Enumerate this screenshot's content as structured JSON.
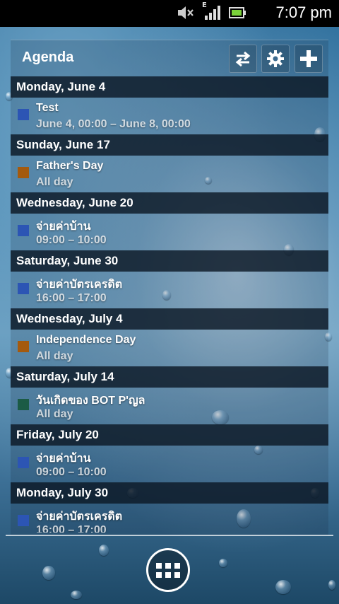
{
  "status": {
    "time": "7:07 pm",
    "network_type": "E",
    "icons": [
      "mute-icon",
      "signal-icon",
      "battery-icon"
    ]
  },
  "widget": {
    "title": "Agenda",
    "buttons": [
      "refresh-icon",
      "gear-icon",
      "plus-icon"
    ]
  },
  "colors": {
    "blue": "#2c55b4",
    "brown": "#a45a0e",
    "green": "#1b5b45"
  },
  "agenda": [
    {
      "date": "Monday, June 4",
      "title": "Test",
      "time": "June 4, 00:00 – June 8, 00:00",
      "color": "#2c55b4"
    },
    {
      "date": "Sunday, June 17",
      "title": "Father's Day",
      "time": "All day",
      "color": "#a45a0e"
    },
    {
      "date": "Wednesday, June 20",
      "title": "จ่ายค่าบ้าน",
      "time": "09:00 – 10:00",
      "color": "#2c55b4"
    },
    {
      "date": "Saturday, June 30",
      "title": "จ่ายค่าบัตรเครดิต",
      "time": "16:00 – 17:00",
      "color": "#2c55b4"
    },
    {
      "date": "Wednesday, July 4",
      "title": "Independence Day",
      "time": "All day",
      "color": "#a45a0e"
    },
    {
      "date": "Saturday, July 14",
      "title": "วันเกิดของ BOT P'ญล",
      "time": "All day",
      "color": "#1b5b45"
    },
    {
      "date": "Friday, July 20",
      "title": "จ่ายค่าบ้าน",
      "time": "09:00 – 10:00",
      "color": "#2c55b4"
    },
    {
      "date": "Monday, July 30",
      "title": "จ่ายค่าบัตรเครดิต",
      "time": "16:00 – 17:00",
      "color": "#2c55b4"
    }
  ]
}
